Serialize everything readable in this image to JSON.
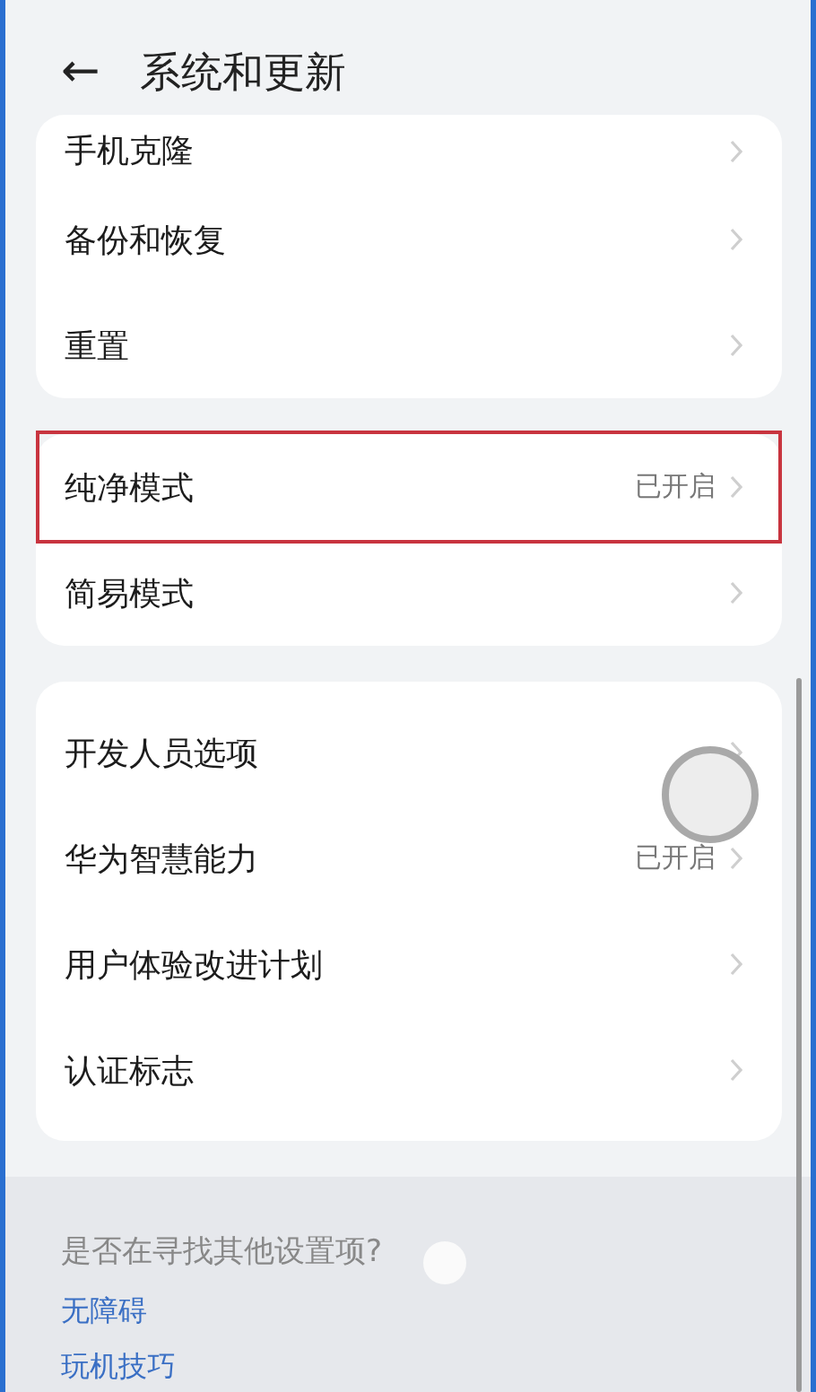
{
  "header": {
    "back_icon": "←",
    "title": "系统和更新"
  },
  "groups": [
    {
      "items": [
        {
          "label": "手机克隆",
          "highlighted": false
        },
        {
          "label": "备份和恢复",
          "highlighted": false
        },
        {
          "label": "重置",
          "highlighted": false
        }
      ]
    },
    {
      "items": [
        {
          "label": "纯净模式",
          "value": "已开启",
          "highlighted": true
        },
        {
          "label": "简易模式",
          "highlighted": false
        }
      ]
    },
    {
      "items": [
        {
          "label": "开发人员选项",
          "highlighted": false
        },
        {
          "label": "华为智慧能力",
          "value": "已开启",
          "highlighted": false
        },
        {
          "label": "用户体验改进计划",
          "highlighted": false
        },
        {
          "label": "认证标志",
          "highlighted": false
        }
      ]
    }
  ],
  "suggestions": {
    "question": "是否在寻找其他设置项?",
    "links": [
      "无障碍",
      "玩机技巧"
    ]
  }
}
